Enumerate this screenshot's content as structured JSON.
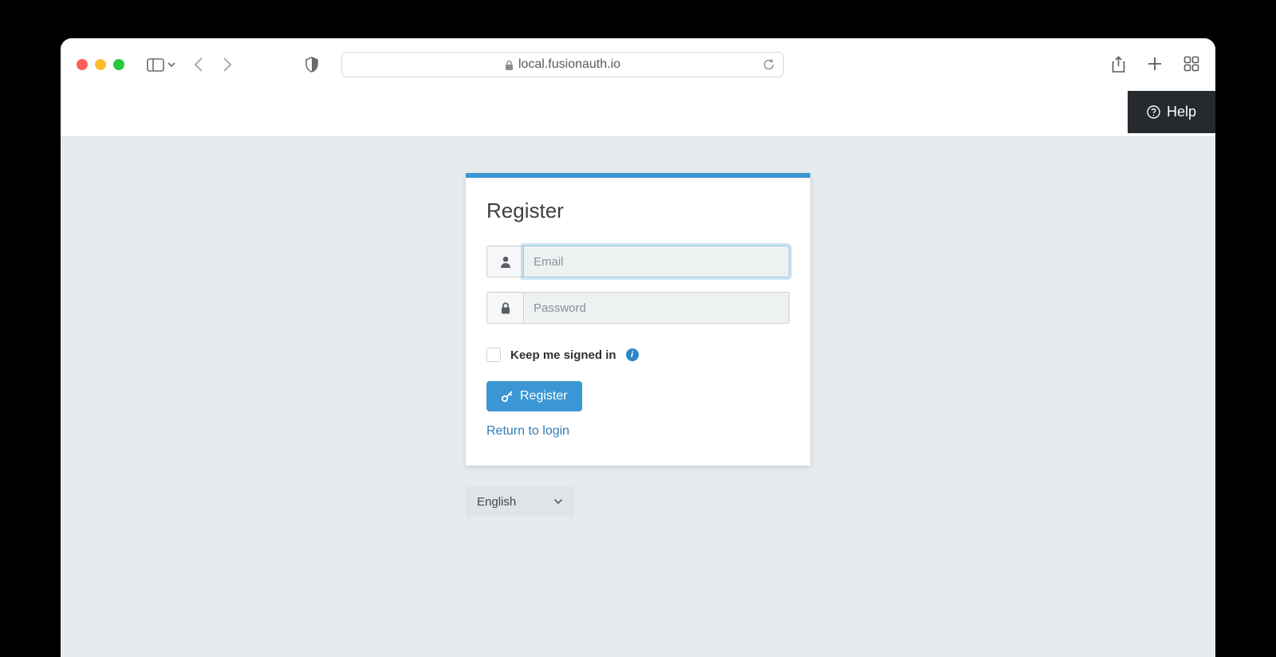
{
  "browser": {
    "url": "local.fusionauth.io"
  },
  "header": {
    "help_label": "Help"
  },
  "card": {
    "title": "Register",
    "email_placeholder": "Email",
    "password_placeholder": "Password",
    "keep_signed_in_label": "Keep me signed in",
    "register_button": "Register",
    "return_link": "Return to login"
  },
  "language": {
    "selected": "English"
  },
  "colors": {
    "accent": "#3b97d3",
    "page_bg": "#e6ebed",
    "help_bg": "#262a2e"
  }
}
